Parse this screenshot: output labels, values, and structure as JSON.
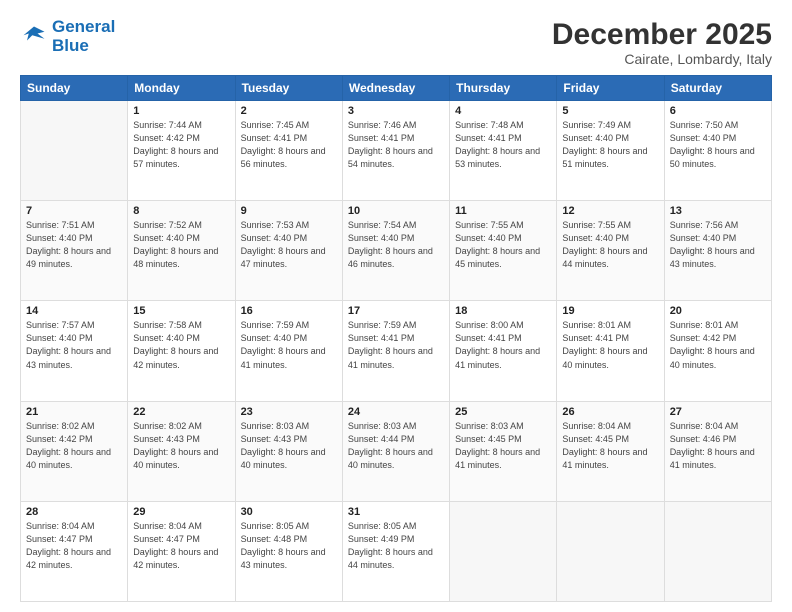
{
  "header": {
    "logo_line1": "General",
    "logo_line2": "Blue",
    "month": "December 2025",
    "location": "Cairate, Lombardy, Italy"
  },
  "weekdays": [
    "Sunday",
    "Monday",
    "Tuesday",
    "Wednesday",
    "Thursday",
    "Friday",
    "Saturday"
  ],
  "weeks": [
    [
      {
        "num": "",
        "sunrise": "",
        "sunset": "",
        "daylight": ""
      },
      {
        "num": "1",
        "sunrise": "Sunrise: 7:44 AM",
        "sunset": "Sunset: 4:42 PM",
        "daylight": "Daylight: 8 hours and 57 minutes."
      },
      {
        "num": "2",
        "sunrise": "Sunrise: 7:45 AM",
        "sunset": "Sunset: 4:41 PM",
        "daylight": "Daylight: 8 hours and 56 minutes."
      },
      {
        "num": "3",
        "sunrise": "Sunrise: 7:46 AM",
        "sunset": "Sunset: 4:41 PM",
        "daylight": "Daylight: 8 hours and 54 minutes."
      },
      {
        "num": "4",
        "sunrise": "Sunrise: 7:48 AM",
        "sunset": "Sunset: 4:41 PM",
        "daylight": "Daylight: 8 hours and 53 minutes."
      },
      {
        "num": "5",
        "sunrise": "Sunrise: 7:49 AM",
        "sunset": "Sunset: 4:40 PM",
        "daylight": "Daylight: 8 hours and 51 minutes."
      },
      {
        "num": "6",
        "sunrise": "Sunrise: 7:50 AM",
        "sunset": "Sunset: 4:40 PM",
        "daylight": "Daylight: 8 hours and 50 minutes."
      }
    ],
    [
      {
        "num": "7",
        "sunrise": "Sunrise: 7:51 AM",
        "sunset": "Sunset: 4:40 PM",
        "daylight": "Daylight: 8 hours and 49 minutes."
      },
      {
        "num": "8",
        "sunrise": "Sunrise: 7:52 AM",
        "sunset": "Sunset: 4:40 PM",
        "daylight": "Daylight: 8 hours and 48 minutes."
      },
      {
        "num": "9",
        "sunrise": "Sunrise: 7:53 AM",
        "sunset": "Sunset: 4:40 PM",
        "daylight": "Daylight: 8 hours and 47 minutes."
      },
      {
        "num": "10",
        "sunrise": "Sunrise: 7:54 AM",
        "sunset": "Sunset: 4:40 PM",
        "daylight": "Daylight: 8 hours and 46 minutes."
      },
      {
        "num": "11",
        "sunrise": "Sunrise: 7:55 AM",
        "sunset": "Sunset: 4:40 PM",
        "daylight": "Daylight: 8 hours and 45 minutes."
      },
      {
        "num": "12",
        "sunrise": "Sunrise: 7:55 AM",
        "sunset": "Sunset: 4:40 PM",
        "daylight": "Daylight: 8 hours and 44 minutes."
      },
      {
        "num": "13",
        "sunrise": "Sunrise: 7:56 AM",
        "sunset": "Sunset: 4:40 PM",
        "daylight": "Daylight: 8 hours and 43 minutes."
      }
    ],
    [
      {
        "num": "14",
        "sunrise": "Sunrise: 7:57 AM",
        "sunset": "Sunset: 4:40 PM",
        "daylight": "Daylight: 8 hours and 43 minutes."
      },
      {
        "num": "15",
        "sunrise": "Sunrise: 7:58 AM",
        "sunset": "Sunset: 4:40 PM",
        "daylight": "Daylight: 8 hours and 42 minutes."
      },
      {
        "num": "16",
        "sunrise": "Sunrise: 7:59 AM",
        "sunset": "Sunset: 4:40 PM",
        "daylight": "Daylight: 8 hours and 41 minutes."
      },
      {
        "num": "17",
        "sunrise": "Sunrise: 7:59 AM",
        "sunset": "Sunset: 4:41 PM",
        "daylight": "Daylight: 8 hours and 41 minutes."
      },
      {
        "num": "18",
        "sunrise": "Sunrise: 8:00 AM",
        "sunset": "Sunset: 4:41 PM",
        "daylight": "Daylight: 8 hours and 41 minutes."
      },
      {
        "num": "19",
        "sunrise": "Sunrise: 8:01 AM",
        "sunset": "Sunset: 4:41 PM",
        "daylight": "Daylight: 8 hours and 40 minutes."
      },
      {
        "num": "20",
        "sunrise": "Sunrise: 8:01 AM",
        "sunset": "Sunset: 4:42 PM",
        "daylight": "Daylight: 8 hours and 40 minutes."
      }
    ],
    [
      {
        "num": "21",
        "sunrise": "Sunrise: 8:02 AM",
        "sunset": "Sunset: 4:42 PM",
        "daylight": "Daylight: 8 hours and 40 minutes."
      },
      {
        "num": "22",
        "sunrise": "Sunrise: 8:02 AM",
        "sunset": "Sunset: 4:43 PM",
        "daylight": "Daylight: 8 hours and 40 minutes."
      },
      {
        "num": "23",
        "sunrise": "Sunrise: 8:03 AM",
        "sunset": "Sunset: 4:43 PM",
        "daylight": "Daylight: 8 hours and 40 minutes."
      },
      {
        "num": "24",
        "sunrise": "Sunrise: 8:03 AM",
        "sunset": "Sunset: 4:44 PM",
        "daylight": "Daylight: 8 hours and 40 minutes."
      },
      {
        "num": "25",
        "sunrise": "Sunrise: 8:03 AM",
        "sunset": "Sunset: 4:45 PM",
        "daylight": "Daylight: 8 hours and 41 minutes."
      },
      {
        "num": "26",
        "sunrise": "Sunrise: 8:04 AM",
        "sunset": "Sunset: 4:45 PM",
        "daylight": "Daylight: 8 hours and 41 minutes."
      },
      {
        "num": "27",
        "sunrise": "Sunrise: 8:04 AM",
        "sunset": "Sunset: 4:46 PM",
        "daylight": "Daylight: 8 hours and 41 minutes."
      }
    ],
    [
      {
        "num": "28",
        "sunrise": "Sunrise: 8:04 AM",
        "sunset": "Sunset: 4:47 PM",
        "daylight": "Daylight: 8 hours and 42 minutes."
      },
      {
        "num": "29",
        "sunrise": "Sunrise: 8:04 AM",
        "sunset": "Sunset: 4:47 PM",
        "daylight": "Daylight: 8 hours and 42 minutes."
      },
      {
        "num": "30",
        "sunrise": "Sunrise: 8:05 AM",
        "sunset": "Sunset: 4:48 PM",
        "daylight": "Daylight: 8 hours and 43 minutes."
      },
      {
        "num": "31",
        "sunrise": "Sunrise: 8:05 AM",
        "sunset": "Sunset: 4:49 PM",
        "daylight": "Daylight: 8 hours and 44 minutes."
      },
      {
        "num": "",
        "sunrise": "",
        "sunset": "",
        "daylight": ""
      },
      {
        "num": "",
        "sunrise": "",
        "sunset": "",
        "daylight": ""
      },
      {
        "num": "",
        "sunrise": "",
        "sunset": "",
        "daylight": ""
      }
    ]
  ]
}
